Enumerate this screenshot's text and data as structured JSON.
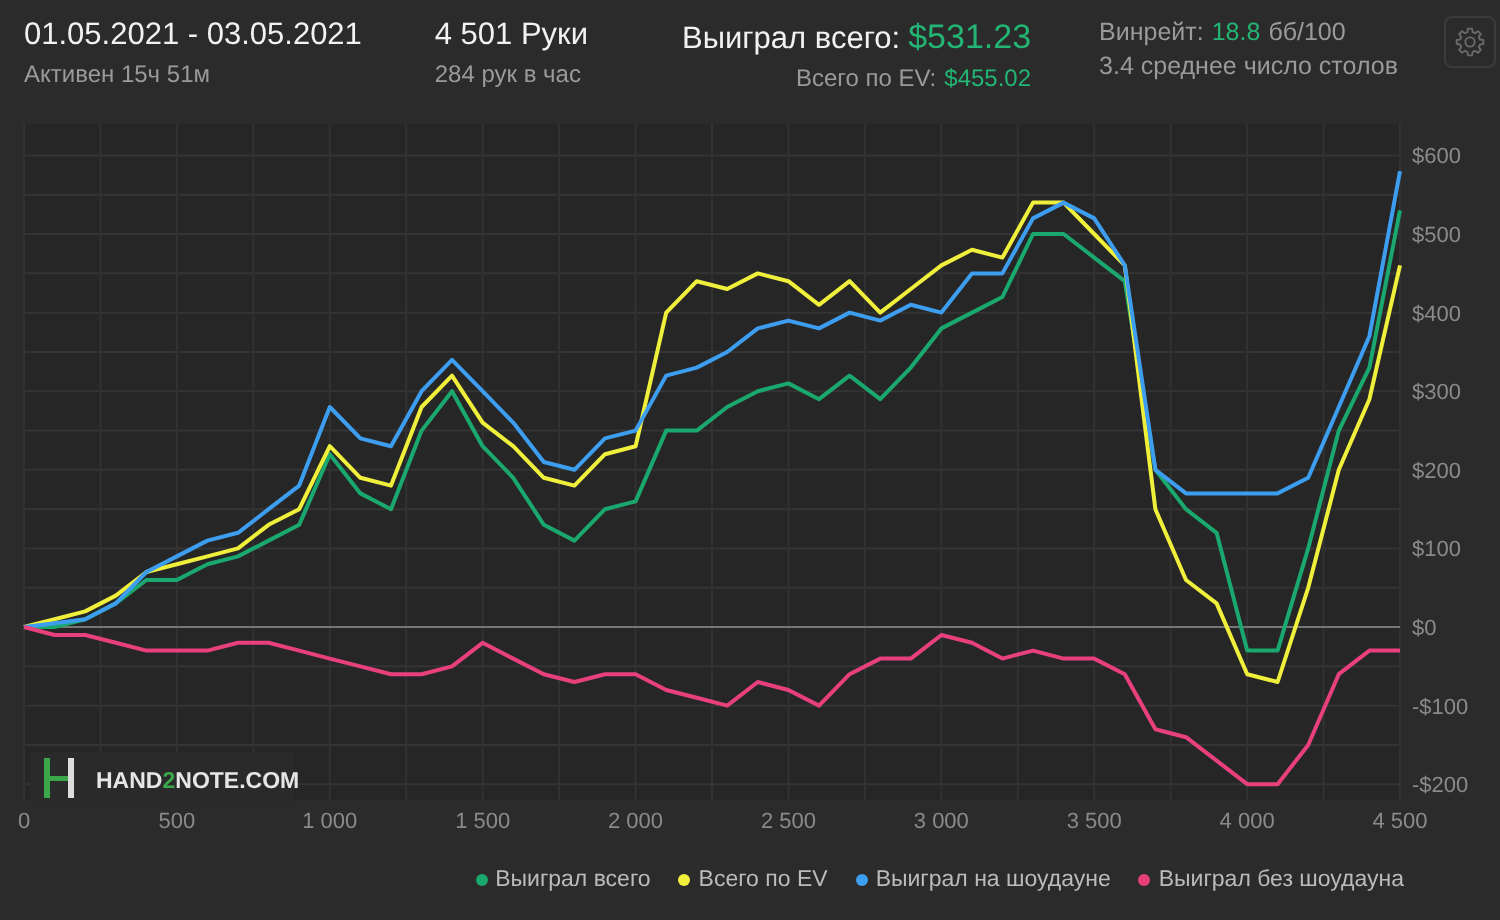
{
  "header": {
    "date_range": "01.05.2021 - 03.05.2021",
    "active": "Активен 15ч 51м",
    "hands": "4 501 Руки",
    "hands_per_hour": "284 рук в час",
    "won_label": "Выиграл всего:",
    "won_value": "$531.23",
    "ev_label": "Всего по EV:",
    "ev_value": "$455.02",
    "winrate_label": "Винрейт:",
    "winrate_value": "18.8",
    "winrate_unit": "бб/100",
    "tables": "3.4 среднее число столов"
  },
  "chart": {
    "logo": {
      "before": "HAND",
      "accent": "2",
      "after": "NOTE.COM"
    },
    "chart_data": {
      "type": "line",
      "grid": true,
      "xlim": [
        0,
        4500
      ],
      "ylim": [
        -220,
        640
      ],
      "xticks": [
        {
          "value": 0,
          "label": "0"
        },
        {
          "value": 500,
          "label": "500"
        },
        {
          "value": 1000,
          "label": "1 000"
        },
        {
          "value": 1500,
          "label": "1 500"
        },
        {
          "value": 2000,
          "label": "2 000"
        },
        {
          "value": 2500,
          "label": "2 500"
        },
        {
          "value": 3000,
          "label": "3 000"
        },
        {
          "value": 3500,
          "label": "3 500"
        },
        {
          "value": 4000,
          "label": "4 000"
        },
        {
          "value": 4500,
          "label": "4 500"
        }
      ],
      "yticks": [
        {
          "value": 600,
          "label": "$600"
        },
        {
          "value": 500,
          "label": "$500"
        },
        {
          "value": 400,
          "label": "$400"
        },
        {
          "value": 300,
          "label": "$300"
        },
        {
          "value": 200,
          "label": "$200"
        },
        {
          "value": 100,
          "label": "$100"
        },
        {
          "value": 0,
          "label": "$0"
        },
        {
          "value": -100,
          "label": "-$100"
        },
        {
          "value": -200,
          "label": "-$200"
        }
      ],
      "x": [
        0,
        100,
        200,
        300,
        400,
        500,
        600,
        700,
        800,
        900,
        1000,
        1100,
        1200,
        1300,
        1400,
        1500,
        1600,
        1700,
        1800,
        1900,
        2000,
        2100,
        2200,
        2300,
        2400,
        2500,
        2600,
        2700,
        2800,
        2900,
        3000,
        3100,
        3200,
        3300,
        3400,
        3500,
        3600,
        3700,
        3800,
        3900,
        4000,
        4100,
        4200,
        4300,
        4400,
        4500
      ],
      "series": [
        {
          "name": "Выиграл всего",
          "color": "#1aa86f",
          "values": [
            0,
            0,
            10,
            30,
            60,
            60,
            80,
            90,
            110,
            130,
            220,
            170,
            150,
            250,
            300,
            230,
            190,
            130,
            110,
            150,
            160,
            250,
            250,
            280,
            300,
            310,
            290,
            320,
            290,
            330,
            380,
            400,
            420,
            500,
            500,
            470,
            440,
            200,
            150,
            120,
            -30,
            -30,
            100,
            250,
            330,
            530
          ]
        },
        {
          "name": "Всего по EV",
          "color": "#f0f03c",
          "values": [
            0,
            10,
            20,
            40,
            70,
            80,
            90,
            100,
            130,
            150,
            230,
            190,
            180,
            280,
            320,
            260,
            230,
            190,
            180,
            220,
            230,
            400,
            440,
            430,
            450,
            440,
            410,
            440,
            400,
            430,
            460,
            480,
            470,
            540,
            540,
            500,
            460,
            150,
            60,
            30,
            -60,
            -70,
            50,
            200,
            290,
            460
          ]
        },
        {
          "name": "Выиграл на шоудауне",
          "color": "#3d9ef0",
          "values": [
            0,
            5,
            10,
            30,
            70,
            90,
            110,
            120,
            150,
            180,
            280,
            240,
            230,
            300,
            340,
            300,
            260,
            210,
            200,
            240,
            250,
            320,
            330,
            350,
            380,
            390,
            380,
            400,
            390,
            410,
            400,
            450,
            450,
            520,
            540,
            520,
            460,
            200,
            170,
            170,
            170,
            170,
            190,
            280,
            370,
            580
          ]
        },
        {
          "name": "Выиграл без шоудауна",
          "color": "#e8407c",
          "values": [
            0,
            -10,
            -10,
            -20,
            -30,
            -30,
            -30,
            -20,
            -20,
            -30,
            -40,
            -50,
            -60,
            -60,
            -50,
            -20,
            -40,
            -60,
            -70,
            -60,
            -60,
            -80,
            -90,
            -100,
            -70,
            -80,
            -100,
            -60,
            -40,
            -40,
            -10,
            -20,
            -40,
            -30,
            -40,
            -40,
            -60,
            -130,
            -140,
            -170,
            -200,
            -200,
            -150,
            -60,
            -30,
            -30
          ]
        }
      ]
    }
  }
}
